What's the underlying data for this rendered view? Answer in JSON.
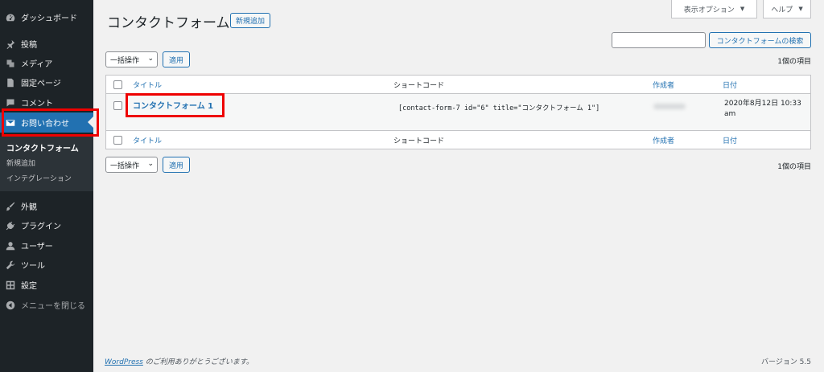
{
  "sidebar": {
    "items": [
      {
        "label": "ダッシュボード",
        "icon": "dashboard-icon"
      },
      {
        "label": "投稿",
        "icon": "pin-icon"
      },
      {
        "label": "メディア",
        "icon": "media-icon"
      },
      {
        "label": "固定ページ",
        "icon": "page-icon"
      },
      {
        "label": "コメント",
        "icon": "comment-icon"
      },
      {
        "label": "お問い合わせ",
        "icon": "mail-icon"
      },
      {
        "label": "外観",
        "icon": "brush-icon"
      },
      {
        "label": "プラグイン",
        "icon": "plugin-icon"
      },
      {
        "label": "ユーザー",
        "icon": "user-icon"
      },
      {
        "label": "ツール",
        "icon": "wrench-icon"
      },
      {
        "label": "設定",
        "icon": "settings-icon"
      },
      {
        "label": "メニューを閉じる",
        "icon": "collapse-icon"
      }
    ],
    "submenu": [
      "コンタクトフォーム",
      "新規追加",
      "インテグレーション"
    ]
  },
  "header": {
    "title": "コンタクトフォーム",
    "add_new": "新規追加",
    "screen_options": "表示オプション",
    "help": "ヘルプ",
    "search_button": "コンタクトフォームの検索"
  },
  "bulk": {
    "label": "一括操作",
    "apply": "適用"
  },
  "item_count": "1個の項目",
  "table": {
    "columns": {
      "title": "タイトル",
      "shortcode": "ショートコード",
      "author": "作成者",
      "date": "日付"
    },
    "rows": [
      {
        "title": "コンタクトフォーム 1",
        "shortcode": "[contact-form-7 id=\"6\" title=\"コンタクトフォーム 1\"]",
        "date": "2020年8月12日 10:33 am"
      }
    ]
  },
  "footer": {
    "link": "WordPress",
    "thanks": " のご利用ありがとうございます。",
    "version": "バージョン 5.5"
  },
  "colors": {
    "accent": "#2271b1",
    "sidebar": "#1d2327",
    "highlight": "#e00000"
  }
}
